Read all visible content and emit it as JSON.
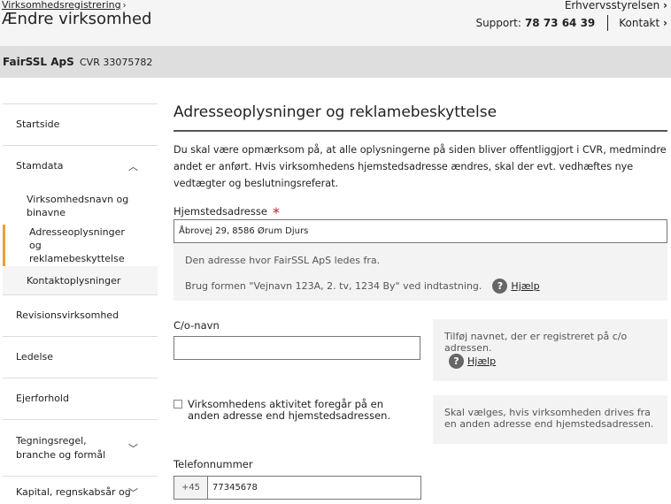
{
  "header": {
    "breadcrumb": "Virksomhedsregistrering",
    "title": "Ændre virksomhed",
    "agency": "Erhvervsstyrelsen",
    "support_label": "Support:",
    "support_phone": "78 73 64 39",
    "contact": "Kontakt"
  },
  "company": {
    "name": "FairSSL ApS",
    "cvr": "CVR 33075782"
  },
  "sidebar": {
    "items": [
      {
        "label": "Startside"
      },
      {
        "label": "Stamdata",
        "expanded": true
      },
      {
        "label": "Revisionsvirksomhed"
      },
      {
        "label": "Ledelse"
      },
      {
        "label": "Ejerforhold"
      },
      {
        "label": "Tegningsregel, branche og formål"
      },
      {
        "label": "Kapital, regnskabsår og"
      }
    ],
    "sub_items": [
      {
        "label": "Virksomhedsnavn og binavne"
      },
      {
        "label": "Adresseoplysninger og reklamebeskyttelse",
        "active": true
      },
      {
        "label": "Kontaktoplysninger"
      }
    ]
  },
  "main": {
    "section_title": "Adresseoplysninger og reklamebeskyttelse",
    "intro": "Du skal være opmærksom på, at alle oplysningerne på siden bliver offentliggjort i CVR, medmindre andet er anført. Hvis virksomhedens hjemstedsadresse ændres, skal der evt. vedhæftes nye vedtægter og beslutningsreferat.",
    "address": {
      "label": "Hjemstedsadresse",
      "required_mark": "*",
      "value": "Åbrovej 29, 8586 Ørum Djurs",
      "help_line1": "Den adresse hvor FairSSL ApS ledes fra.",
      "help_line2": "Brug formen \"Vejnavn 123A, 2. tv, 1234 By\" ved indtastning.",
      "help_link": "Hjælp"
    },
    "co_name": {
      "label": "C/o-navn",
      "value": "",
      "help_text": "Tilføj navnet, der er registreret på c/o adressen.",
      "help_link": "Hjælp"
    },
    "activity": {
      "label": "Virksomhedens aktivitet foregår på en anden adresse end hjemstedsadressen.",
      "checked": false,
      "help_text": "Skal vælges, hvis virksomheden drives fra en anden adresse end hjemstedsadressen."
    },
    "phone": {
      "label": "Telefonnummer",
      "prefix": "+45",
      "value": "77345678"
    }
  },
  "icons": {
    "help": "?",
    "chevron_up": "︿",
    "chevron_down": "﹀",
    "chevron_right": "›"
  }
}
